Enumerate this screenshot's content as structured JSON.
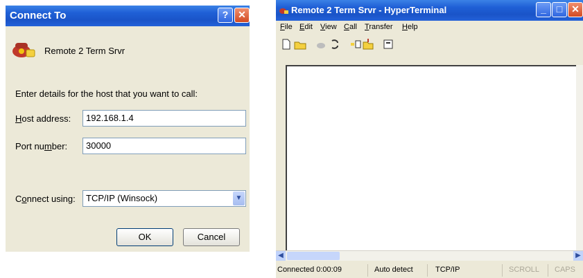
{
  "connect_dialog": {
    "title": "Connect To",
    "session_name": "Remote 2 Term Srvr",
    "prompt": "Enter details for the host that you want to call:",
    "host_label_pre": "",
    "host_label_ul": "H",
    "host_label_post": "ost address:",
    "host_value": "192.168.1.4",
    "port_label_pre": "Port nu",
    "port_label_ul": "m",
    "port_label_post": "ber:",
    "port_value": "30000",
    "connect_label_pre": "C",
    "connect_label_ul": "o",
    "connect_label_post": "nnect using:",
    "connect_value": "TCP/IP (Winsock)",
    "ok_label": "OK",
    "cancel_label": "Cancel",
    "help_glyph": "?",
    "close_glyph": "✕"
  },
  "hyperterminal": {
    "title": "Remote 2 Term Srvr - HyperTerminal",
    "menu": [
      {
        "pre": "",
        "ul": "F",
        "post": "ile"
      },
      {
        "pre": "",
        "ul": "E",
        "post": "dit"
      },
      {
        "pre": "",
        "ul": "V",
        "post": "iew"
      },
      {
        "pre": "",
        "ul": "C",
        "post": "all"
      },
      {
        "pre": "",
        "ul": "T",
        "post": "ransfer"
      },
      {
        "pre": "",
        "ul": "H",
        "post": "elp"
      }
    ],
    "status": {
      "connection": "Connected 0:00:09",
      "detect": "Auto detect",
      "protocol": "TCP/IP",
      "scroll": "SCROLL",
      "caps": "CAPS"
    },
    "window_buttons": {
      "minimize": "_",
      "maximize": "□",
      "close": "✕"
    },
    "scroll_left": "◀",
    "scroll_right": "▶"
  }
}
